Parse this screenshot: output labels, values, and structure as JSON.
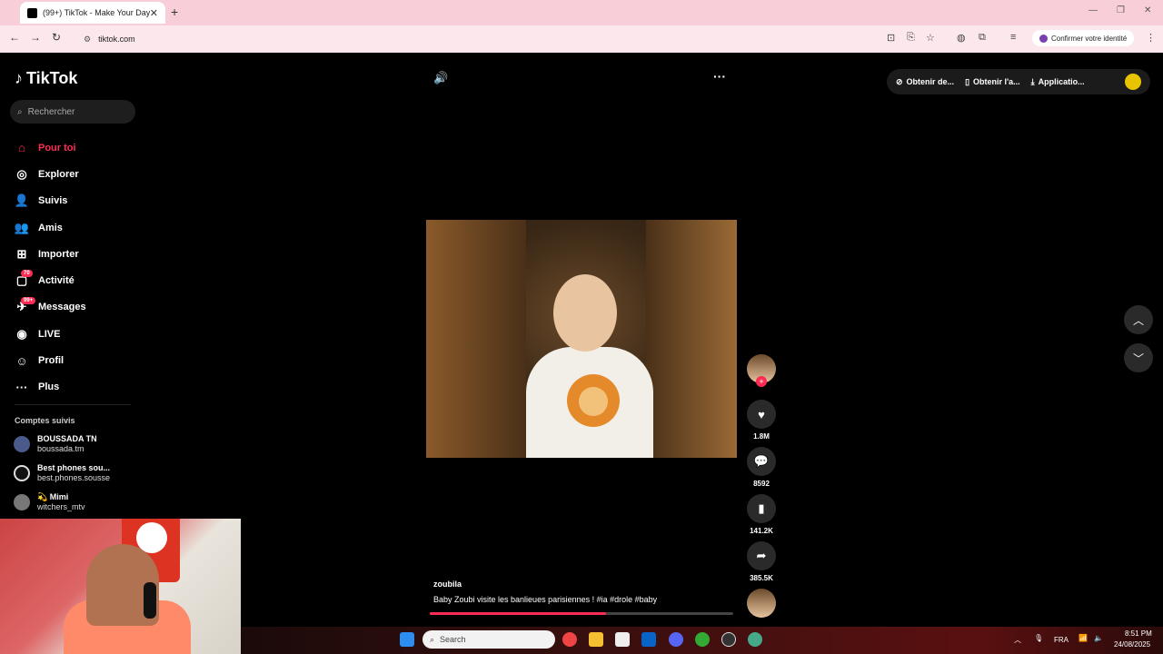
{
  "browser": {
    "tab_title": "(99+) TikTok - Make Your Day",
    "tab_close": "✕",
    "new_tab": "+",
    "url": "tiktok.com",
    "confirm_identity": "Confirmer votre identité",
    "win_min": "—",
    "win_max": "❐",
    "win_close": "✕"
  },
  "app": {
    "logo_text": "TikTok",
    "search_placeholder": "Rechercher"
  },
  "nav": [
    {
      "label": "Pour toi",
      "icon": "home-icon",
      "glyph": "⌂",
      "active": true
    },
    {
      "label": "Explorer",
      "icon": "compass-icon",
      "glyph": "◎"
    },
    {
      "label": "Suivis",
      "icon": "following-icon",
      "glyph": "👤"
    },
    {
      "label": "Amis",
      "icon": "friends-icon",
      "glyph": "👥"
    },
    {
      "label": "Importer",
      "icon": "upload-icon",
      "glyph": "⊞"
    },
    {
      "label": "Activité",
      "icon": "activity-icon",
      "glyph": "▢",
      "badge": "70"
    },
    {
      "label": "Messages",
      "icon": "messages-icon",
      "glyph": "✈",
      "badge": "99+"
    },
    {
      "label": "LIVE",
      "icon": "live-icon",
      "glyph": "◉"
    },
    {
      "label": "Profil",
      "icon": "profile-icon",
      "glyph": "☺"
    },
    {
      "label": "Plus",
      "icon": "more-icon",
      "glyph": "···"
    }
  ],
  "following": {
    "title": "Comptes suivis",
    "accounts": [
      {
        "name": "BOUSSADA TN",
        "handle": "boussada.tm"
      },
      {
        "name": "Best phones sou...",
        "handle": "best.phones.sousse"
      },
      {
        "name": "💫 Mimi",
        "handle": "witchers_mtv"
      }
    ]
  },
  "video": {
    "author": "zoubila",
    "caption": "Baby Zoubi visite les banlieues parisiennes ! #ia  #drole  #baby",
    "progress": 0.58
  },
  "actions": {
    "likes": "1.8M",
    "comments": "8592",
    "saves": "141.2K",
    "shares": "385.5K",
    "follow_plus": "+"
  },
  "top_actions": [
    {
      "label": "Obtenir de...",
      "glyph": "⊘"
    },
    {
      "label": "Obtenir l'a...",
      "glyph": "▯"
    },
    {
      "label": "Applicatio...",
      "glyph": "⤓"
    }
  ],
  "taskbar": {
    "search": "Search",
    "lang": "FRA",
    "time": "8:51 PM",
    "date": "24/08/2025"
  },
  "colors": {
    "accent": "#fe2c55"
  }
}
